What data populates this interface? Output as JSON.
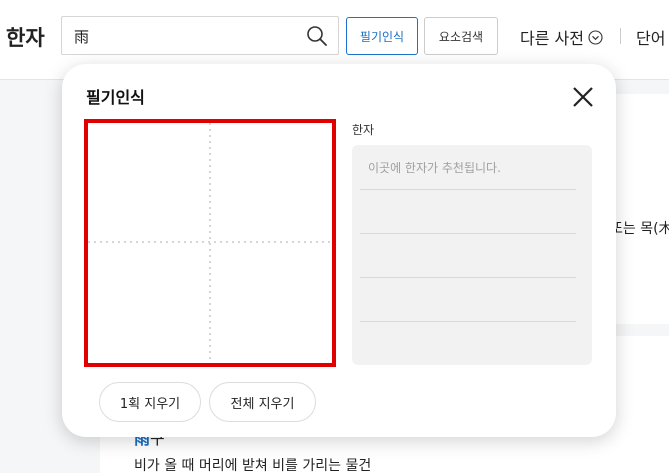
{
  "header": {
    "brand": "한자",
    "search_value": "雨",
    "handwriting_button": "필기인식",
    "element_search_button": "요소검색",
    "other_dict": "다른 사전",
    "word_menu": "단어"
  },
  "background": {
    "snippet_text": "또는 목(木",
    "entry_hanja": "雨",
    "entry_rest": "구 ",
    "entry_definition": "비가 올 때 머리에 받쳐 비를 가리는 물건"
  },
  "modal": {
    "title": "필기인식",
    "candidate_label": "한자",
    "candidate_placeholder": "이곳에 한자가 추천됩니다.",
    "clear_one_button": "1획 지우기",
    "clear_all_button": "전체 지우기"
  },
  "colors": {
    "canvas_border": "#e00000",
    "accent_blue": "#1a6fc0"
  }
}
